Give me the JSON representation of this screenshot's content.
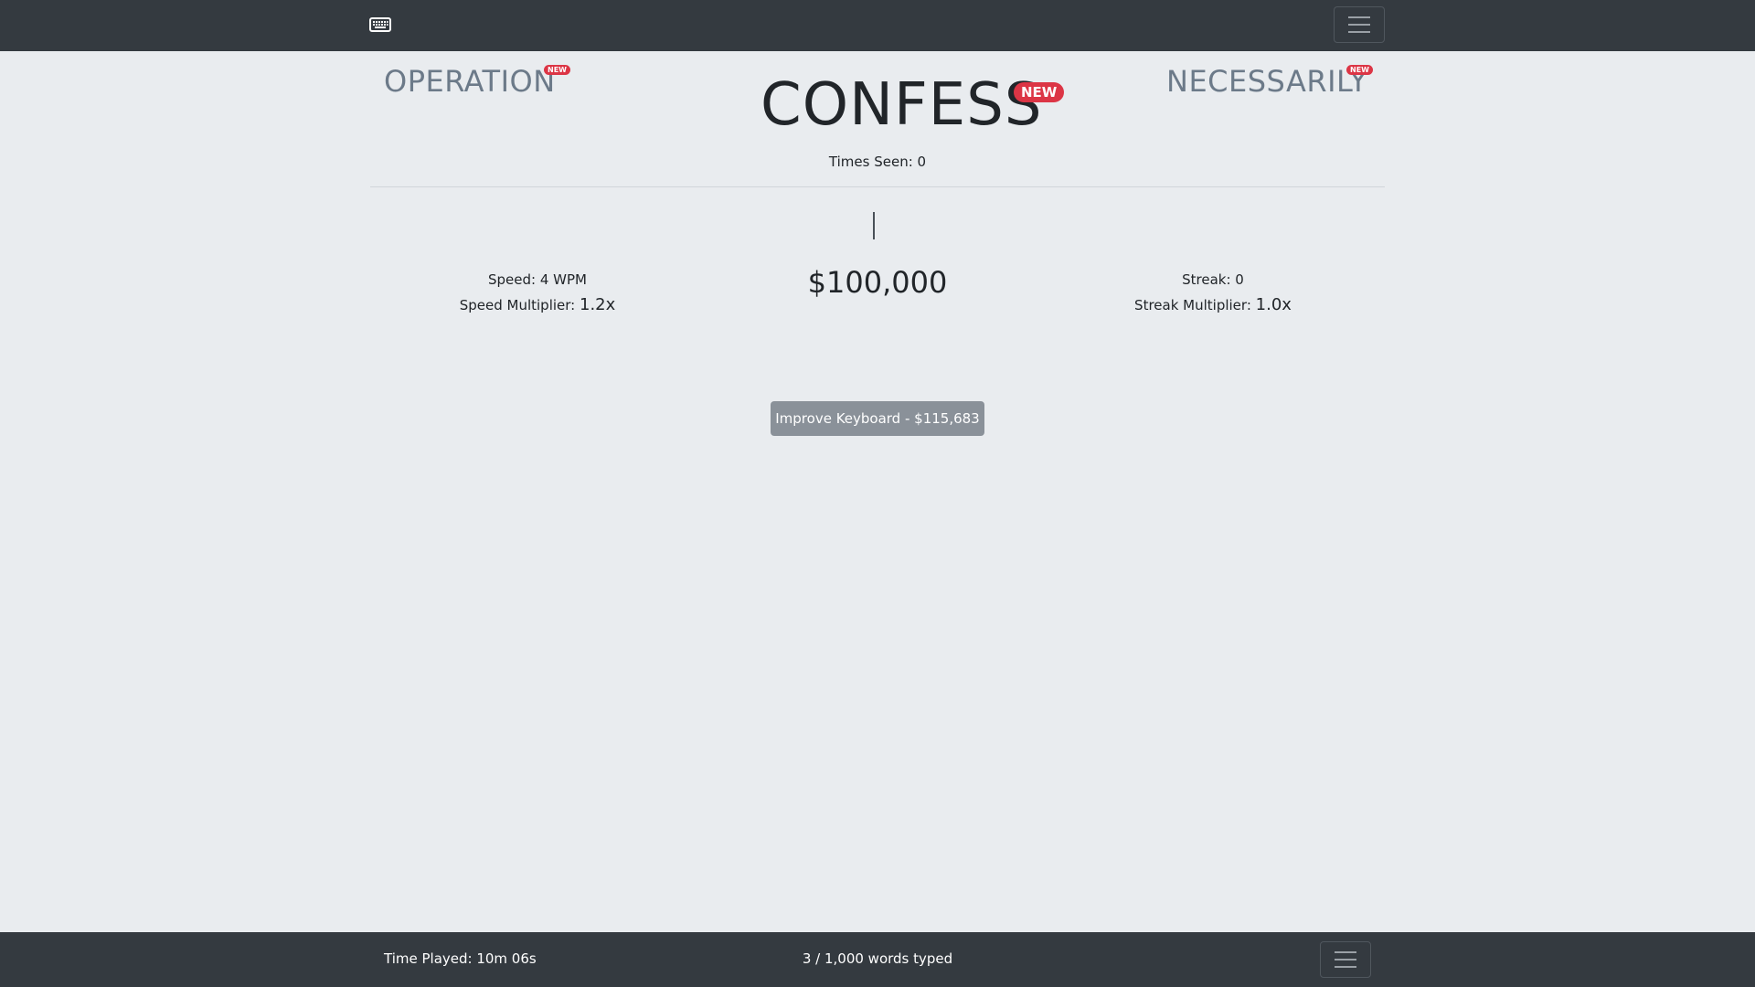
{
  "header": {
    "keyboard_icon": "keyboard-icon",
    "menu_icon": "hamburger-icon"
  },
  "words": {
    "previous": "OPERATION",
    "current": "CONFESS",
    "next": "NECESSARILY",
    "badge": "NEW"
  },
  "times_seen": "Times Seen: 0",
  "stats": {
    "speed": "Speed: 4 WPM",
    "speed_multiplier_label": "Speed Multiplier:",
    "speed_multiplier_value": "1.2x",
    "money": "$100,000",
    "streak": "Streak: 0",
    "streak_multiplier_label": "Streak Multiplier:",
    "streak_multiplier_value": "1.0x"
  },
  "improve_button": "Improve Keyboard - $115,683",
  "footer": {
    "time_played": "Time Played: 10m 06s",
    "words_typed": "3 / 1,000 words typed"
  },
  "colors": {
    "navbar": "#343a40",
    "background": "#e9ecef",
    "badge": "#dc3545",
    "button": "#8a9199"
  }
}
